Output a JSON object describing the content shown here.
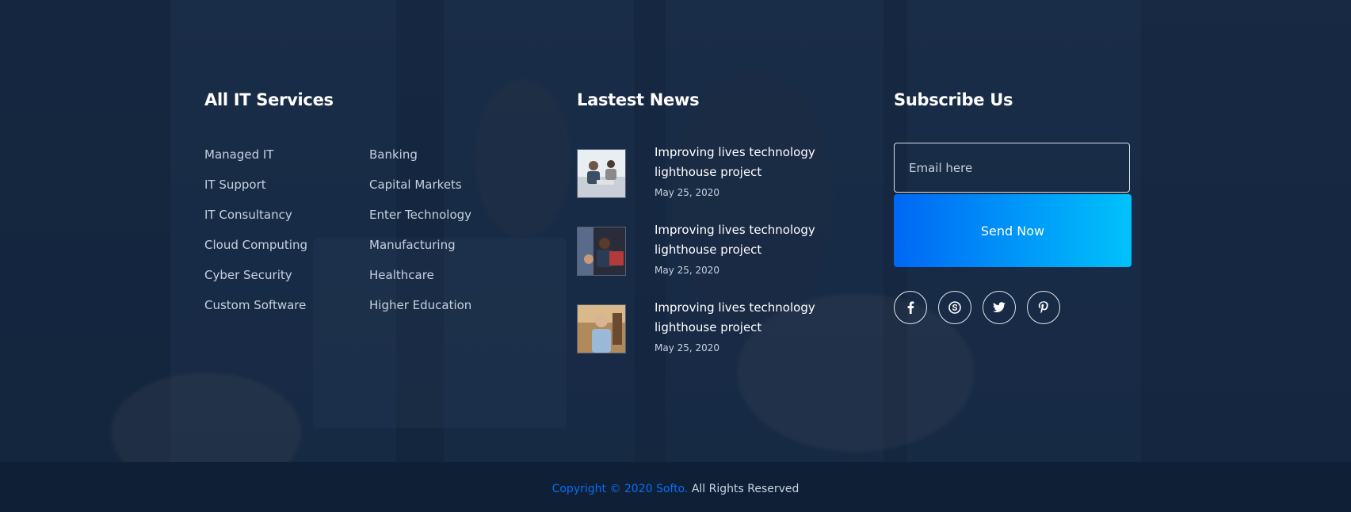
{
  "services": {
    "title": "All IT Services",
    "col1": [
      "Managed IT",
      "IT Support",
      "IT Consultancy",
      "Cloud Computing",
      "Cyber Security",
      "Custom Software"
    ],
    "col2": [
      "Banking",
      "Capital Markets",
      "Enter Technology",
      "Manufacturing",
      "Healthcare",
      "Higher Education"
    ]
  },
  "news": {
    "title": "Lastest News",
    "items": [
      {
        "title": "Improving lives technology lighthouse project",
        "date": "May 25, 2020"
      },
      {
        "title": "Improving lives technology lighthouse project",
        "date": "May 25, 2020"
      },
      {
        "title": "Improving lives technology lighthouse project",
        "date": "May 25, 2020"
      }
    ]
  },
  "subscribe": {
    "title": "Subscribe Us",
    "email_placeholder": "Email here",
    "email_value": "",
    "button_label": "Send Now",
    "social": [
      "facebook-icon",
      "skype-icon",
      "twitter-icon",
      "pinterest-icon"
    ]
  },
  "footer": {
    "copyright_brand": "Copyright © 2020 Softo.",
    "copyright_rest": " All Rights Reserved"
  },
  "colors": {
    "accent": "#0a6cf5",
    "button_gradient_start": "#0067f4",
    "button_gradient_end": "#00c2fb",
    "overlay": "#1c314f",
    "bottom_bar": "#0f2036"
  }
}
